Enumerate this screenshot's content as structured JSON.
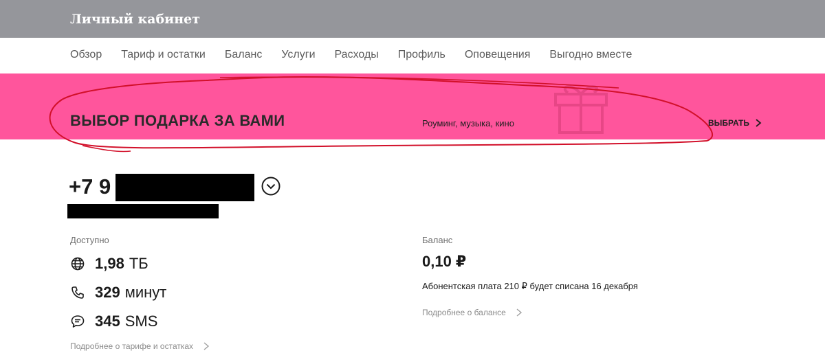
{
  "header": {
    "title": "Личный кабинет"
  },
  "nav": {
    "items": [
      "Обзор",
      "Тариф и остатки",
      "Баланс",
      "Услуги",
      "Расходы",
      "Профиль",
      "Оповещения",
      "Выгодно вместе"
    ]
  },
  "banner": {
    "headline": "ВЫБОР ПОДАРКА ЗА ВАМИ",
    "subtitle": "Роуминг, музыка, кино",
    "cta": "ВЫБРАТЬ",
    "background": "#ff559c",
    "annotation_color": "#d2102a"
  },
  "account": {
    "phone_prefix": "+7 9"
  },
  "available": {
    "label": "Доступно",
    "internet_value": "1,98",
    "internet_unit": "ТБ",
    "minutes_value": "329",
    "minutes_unit": "минут",
    "sms_value": "345",
    "sms_unit": "SMS",
    "details_link": "Подробнее о тарифе и остатках"
  },
  "balance": {
    "label": "Баланс",
    "value": "0,10 ₽",
    "fee_text": "Абонентская плата 210 ₽ будет списана 16 декабря",
    "details_link": "Подробнее о балансе"
  },
  "colors": {
    "header_bg": "#95969b",
    "accent_pink": "#ff559c"
  }
}
